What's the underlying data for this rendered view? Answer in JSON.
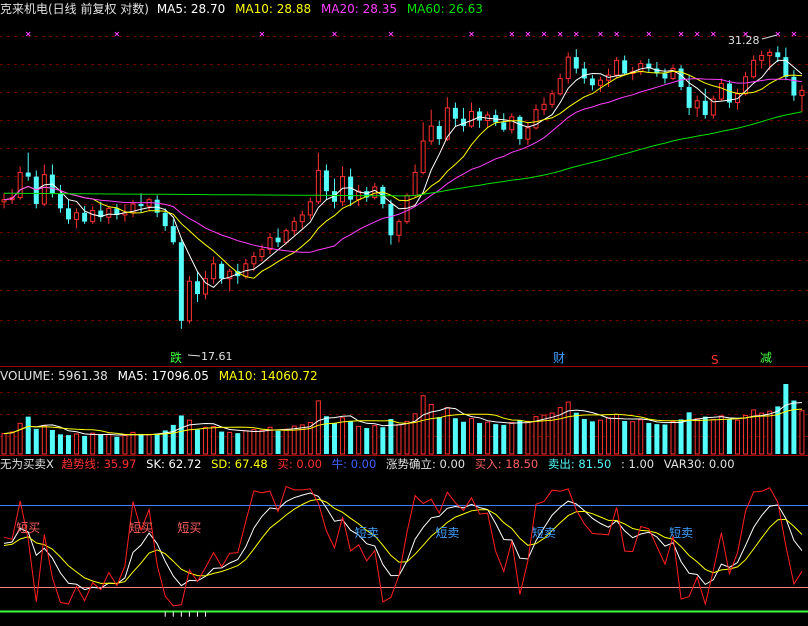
{
  "colors": {
    "up": "#ff3030",
    "down": "#54fcfc",
    "ma5": "#ffffff",
    "ma10": "#ffff00",
    "ma20": "#ff40ff",
    "ma60": "#00e000",
    "frame": "#a00000",
    "grid": "#6a0000",
    "label": "#e0e0e0",
    "blue_line": "#4080ff",
    "sig_buy": "#ff6060",
    "sig_sell": "#40a0ff"
  },
  "header": {
    "title": "克来机电(日线 前复权 对数)",
    "ma5": "MA5: 28.70",
    "ma10": "MA10: 28.88",
    "ma20": "MA20: 28.35",
    "ma60": "MA60: 26.63"
  },
  "volume_header": {
    "volume": "VOLUME: 5961.38",
    "ma5": "MA5: 17096.05",
    "ma10": "MA10: 14060.72"
  },
  "indicator_header": {
    "name": "无为买卖X",
    "trend": "趋势线: 35.97",
    "sk": "SK: 62.72",
    "sd": "SD: 67.48",
    "buy": "买: 0.00",
    "bull": "牛: 0.00",
    "rise": "涨势确立: 0.00",
    "buy_in": "买入: 18.50",
    "sell_out": "卖出: 81.50",
    "one": ": 1.00",
    "var30": "VAR30: 0.00"
  },
  "annotations": {
    "high_label": "31.28",
    "low_label": "17.61",
    "tag_die": "跌",
    "tag_cai": "财",
    "tag_s": "S",
    "tag_jian": "减",
    "short_buy": "短买",
    "short_sell": "短卖"
  },
  "chart_data": {
    "type": "candlestick",
    "scale": "log",
    "price_ylim": [
      16.8,
      33.0
    ],
    "candles": [
      [
        22.8,
        23.2,
        22.5,
        22.9
      ],
      [
        22.9,
        23.4,
        22.7,
        23.0
      ],
      [
        23.0,
        24.5,
        22.9,
        24.2
      ],
      [
        24.2,
        25.2,
        23.8,
        24.0
      ],
      [
        24.0,
        24.3,
        22.5,
        22.7
      ],
      [
        22.7,
        24.6,
        22.6,
        24.1
      ],
      [
        24.1,
        24.6,
        23.0,
        23.2
      ],
      [
        23.2,
        23.6,
        22.3,
        22.5
      ],
      [
        22.5,
        22.9,
        21.8,
        22.0
      ],
      [
        22.0,
        22.5,
        21.6,
        22.3
      ],
      [
        22.3,
        22.6,
        21.8,
        21.9
      ],
      [
        21.9,
        22.6,
        21.8,
        22.4
      ],
      [
        22.4,
        22.8,
        21.9,
        22.1
      ],
      [
        22.1,
        22.6,
        21.8,
        22.5
      ],
      [
        22.5,
        22.7,
        22.0,
        22.2
      ],
      [
        22.2,
        22.7,
        21.9,
        22.3
      ],
      [
        22.3,
        22.9,
        22.1,
        22.7
      ],
      [
        22.7,
        23.2,
        22.3,
        22.6
      ],
      [
        22.6,
        23.0,
        22.4,
        22.9
      ],
      [
        22.9,
        23.1,
        22.1,
        22.3
      ],
      [
        22.3,
        22.5,
        21.5,
        21.7
      ],
      [
        21.7,
        22.0,
        20.9,
        21.0
      ],
      [
        21.0,
        21.2,
        17.61,
        17.9
      ],
      [
        17.9,
        19.6,
        17.8,
        19.4
      ],
      [
        19.4,
        19.8,
        18.6,
        18.9
      ],
      [
        18.9,
        19.8,
        18.7,
        19.5
      ],
      [
        19.5,
        20.4,
        19.3,
        20.1
      ],
      [
        20.1,
        20.2,
        19.3,
        19.5
      ],
      [
        19.5,
        19.9,
        19.0,
        19.8
      ],
      [
        19.8,
        20.1,
        19.3,
        19.6
      ],
      [
        19.6,
        20.3,
        19.5,
        20.1
      ],
      [
        20.1,
        20.6,
        19.8,
        20.4
      ],
      [
        20.4,
        20.9,
        20.2,
        20.7
      ],
      [
        20.7,
        21.4,
        20.5,
        21.2
      ],
      [
        21.2,
        21.6,
        20.8,
        21.0
      ],
      [
        21.0,
        21.6,
        20.9,
        21.5
      ],
      [
        21.5,
        22.1,
        21.3,
        21.9
      ],
      [
        21.9,
        22.4,
        21.6,
        22.2
      ],
      [
        22.2,
        23.0,
        22.0,
        22.8
      ],
      [
        22.8,
        25.2,
        22.7,
        24.3
      ],
      [
        24.3,
        24.6,
        22.9,
        23.3
      ],
      [
        23.3,
        23.9,
        22.5,
        22.8
      ],
      [
        22.8,
        24.5,
        22.6,
        24.0
      ],
      [
        24.0,
        24.4,
        22.6,
        22.9
      ],
      [
        22.9,
        23.6,
        22.6,
        23.3
      ],
      [
        23.3,
        23.5,
        22.8,
        23.0
      ],
      [
        23.0,
        23.7,
        22.9,
        23.5
      ],
      [
        23.5,
        23.6,
        22.5,
        22.7
      ],
      [
        22.7,
        22.9,
        20.9,
        21.3
      ],
      [
        21.3,
        22.0,
        21.0,
        21.9
      ],
      [
        21.9,
        23.2,
        21.8,
        23.1
      ],
      [
        23.1,
        24.6,
        23.0,
        24.2
      ],
      [
        24.2,
        26.8,
        24.1,
        25.8
      ],
      [
        25.8,
        27.5,
        25.6,
        26.6
      ],
      [
        26.6,
        26.9,
        25.6,
        25.9
      ],
      [
        25.9,
        28.2,
        25.8,
        27.6
      ],
      [
        27.6,
        27.9,
        26.6,
        27.0
      ],
      [
        27.0,
        27.6,
        26.3,
        26.6
      ],
      [
        26.6,
        27.9,
        26.5,
        27.4
      ],
      [
        27.4,
        27.6,
        26.5,
        26.9
      ],
      [
        26.9,
        27.4,
        26.5,
        27.2
      ],
      [
        27.2,
        27.5,
        26.6,
        26.8
      ],
      [
        26.8,
        27.3,
        26.3,
        26.4
      ],
      [
        26.4,
        27.3,
        26.2,
        27.1
      ],
      [
        27.1,
        27.2,
        25.6,
        25.9
      ],
      [
        25.9,
        26.8,
        25.6,
        26.5
      ],
      [
        26.5,
        27.8,
        26.4,
        27.5
      ],
      [
        27.5,
        28.2,
        27.2,
        27.8
      ],
      [
        27.8,
        28.6,
        27.6,
        28.4
      ],
      [
        28.4,
        29.6,
        28.3,
        29.3
      ],
      [
        29.3,
        30.9,
        29.0,
        30.6
      ],
      [
        30.6,
        31.1,
        29.6,
        29.9
      ],
      [
        29.9,
        30.3,
        29.0,
        29.3
      ],
      [
        29.3,
        29.5,
        28.6,
        28.9
      ],
      [
        28.9,
        29.4,
        28.5,
        29.2
      ],
      [
        29.2,
        29.9,
        28.8,
        29.5
      ],
      [
        29.5,
        30.6,
        29.3,
        30.4
      ],
      [
        30.4,
        30.7,
        29.5,
        29.6
      ],
      [
        29.6,
        30.0,
        29.2,
        29.7
      ],
      [
        29.7,
        30.4,
        29.5,
        30.2
      ],
      [
        30.2,
        30.5,
        29.7,
        29.9
      ],
      [
        29.9,
        30.3,
        29.4,
        29.6
      ],
      [
        29.6,
        29.9,
        29.0,
        29.3
      ],
      [
        29.3,
        30.1,
        29.2,
        29.9
      ],
      [
        29.9,
        30.1,
        28.6,
        28.8
      ],
      [
        28.8,
        29.5,
        27.2,
        27.6
      ],
      [
        27.6,
        28.3,
        27.1,
        28.0
      ],
      [
        28.0,
        28.7,
        27.0,
        27.2
      ],
      [
        27.2,
        28.3,
        27.0,
        28.1
      ],
      [
        28.1,
        29.3,
        28.0,
        29.0
      ],
      [
        29.0,
        29.2,
        27.6,
        27.9
      ],
      [
        27.9,
        28.7,
        27.5,
        28.4
      ],
      [
        28.4,
        29.7,
        28.3,
        29.4
      ],
      [
        29.4,
        30.7,
        29.3,
        30.4
      ],
      [
        30.4,
        31.0,
        29.9,
        30.7
      ],
      [
        30.7,
        31.1,
        29.8,
        30.9
      ],
      [
        30.9,
        31.28,
        30.3,
        30.6
      ],
      [
        30.6,
        31.2,
        29.2,
        29.4
      ],
      [
        29.4,
        29.8,
        28.0,
        28.3
      ],
      [
        28.3,
        28.9,
        27.4,
        28.6
      ]
    ],
    "volumes": [
      5.2,
      5.6,
      7.8,
      9.5,
      6.4,
      7.2,
      6.1,
      5.0,
      4.8,
      5.1,
      4.6,
      5.3,
      4.9,
      5.0,
      4.4,
      4.7,
      5.5,
      5.1,
      4.9,
      5.2,
      6.0,
      7.4,
      9.8,
      8.6,
      6.2,
      6.8,
      7.0,
      5.7,
      5.5,
      5.3,
      5.9,
      6.2,
      6.0,
      6.8,
      5.9,
      6.3,
      7.1,
      7.4,
      8.0,
      13.5,
      9.6,
      7.8,
      9.2,
      8.4,
      7.0,
      6.6,
      7.2,
      6.8,
      8.9,
      7.5,
      8.3,
      10.2,
      14.8,
      12.6,
      9.4,
      11.8,
      9.1,
      8.2,
      9.0,
      7.9,
      8.1,
      7.6,
      7.4,
      8.0,
      8.6,
      8.3,
      9.5,
      9.9,
      10.4,
      11.8,
      13.2,
      10.5,
      8.9,
      8.3,
      8.6,
      9.2,
      10.1,
      8.4,
      8.2,
      8.7,
      7.9,
      7.6,
      7.5,
      8.3,
      8.8,
      10.6,
      9.0,
      9.5,
      8.8,
      9.7,
      8.9,
      8.6,
      9.8,
      11.2,
      10.4,
      10.9,
      12.1,
      17.8,
      13.6,
      11.0
    ],
    "indicator_ylim": [
      -5,
      105
    ]
  }
}
